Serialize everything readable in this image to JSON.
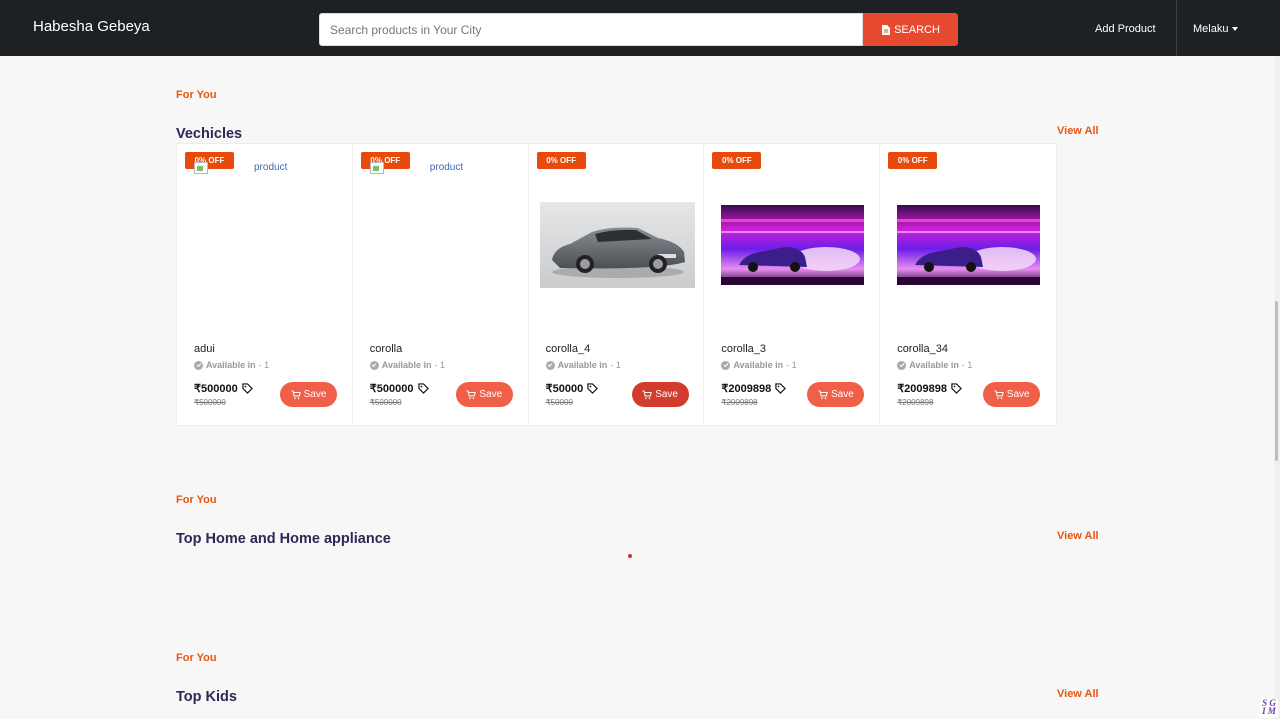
{
  "navbar": {
    "brand": "Habesha Gebeya",
    "search_placeholder": "Search products in Your City",
    "search_button": "SEARCH",
    "add_product": "Add Product",
    "user_name": "Melaku"
  },
  "sections": [
    {
      "eyebrow": "For You",
      "title": "Vechicles",
      "view_all": "View All",
      "products": [
        {
          "badge": "0% OFF",
          "image": "broken",
          "image_alt": "product",
          "name": "adui",
          "availability_label": "Available in",
          "availability_value": "- 1",
          "price": "₹500000",
          "old_price": "₹500000",
          "save": "Save"
        },
        {
          "badge": "0% OFF",
          "image": "broken",
          "image_alt": "product",
          "name": "corolla",
          "availability_label": "Available in",
          "availability_value": "- 1",
          "price": "₹500000",
          "old_price": "₹500000",
          "save": "Save"
        },
        {
          "badge": "0% OFF",
          "image": "grey-car-photo",
          "name": "corolla_4",
          "availability_label": "Available in",
          "availability_value": "- 1",
          "price": "₹50000",
          "old_price": "₹50000",
          "save": "Save"
        },
        {
          "badge": "0% OFF",
          "image": "neon-car-photo",
          "name": "corolla_3",
          "availability_label": "Available in",
          "availability_value": "- 1",
          "price": "₹2009898",
          "old_price": "₹2009898",
          "save": "Save"
        },
        {
          "badge": "0% OFF",
          "image": "neon-car-photo",
          "name": "corolla_34",
          "availability_label": "Available in",
          "availability_value": "- 1",
          "price": "₹2009898",
          "old_price": "₹2009898",
          "save": "Save"
        }
      ]
    },
    {
      "eyebrow": "For You",
      "title": "Top Home and Home appliance",
      "view_all": "View All",
      "products": []
    },
    {
      "eyebrow": "For You",
      "title": "Top Kids",
      "view_all": "View All",
      "products": []
    }
  ],
  "colors": {
    "navbar_bg": "#1e2124",
    "accent_orange": "#e8560f",
    "search_red": "#e84a2f",
    "title_purple": "#2f2757",
    "save_button": "#f06049"
  },
  "corner_logo": "SG IM"
}
